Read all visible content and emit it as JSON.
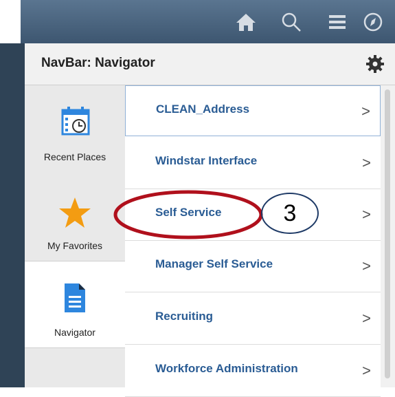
{
  "topbar": {
    "icons": [
      "home-icon",
      "search-icon",
      "menu-icon",
      "compass-icon"
    ]
  },
  "panel": {
    "title": "NavBar: Navigator",
    "settings_icon": "gear-icon"
  },
  "side_tabs": [
    {
      "label": "Recent Places",
      "icon": "calendar-clock-icon"
    },
    {
      "label": "My Favorites",
      "icon": "star-icon"
    },
    {
      "label": "Navigator",
      "icon": "document-icon"
    }
  ],
  "nav_items": [
    {
      "label": "CLEAN_Address"
    },
    {
      "label": "Windstar Interface"
    },
    {
      "label": "Self Service"
    },
    {
      "label": "Manager Self Service"
    },
    {
      "label": "Recruiting"
    },
    {
      "label": "Workforce Administration"
    }
  ],
  "chevron": ">",
  "annotation": {
    "step_number": "3"
  },
  "colors": {
    "topbar": "#4a6580",
    "link": "#2a5c94",
    "highlight_oval": "#b0101c",
    "favorites_star": "#f39c12",
    "navigator_icon": "#2e86de"
  }
}
